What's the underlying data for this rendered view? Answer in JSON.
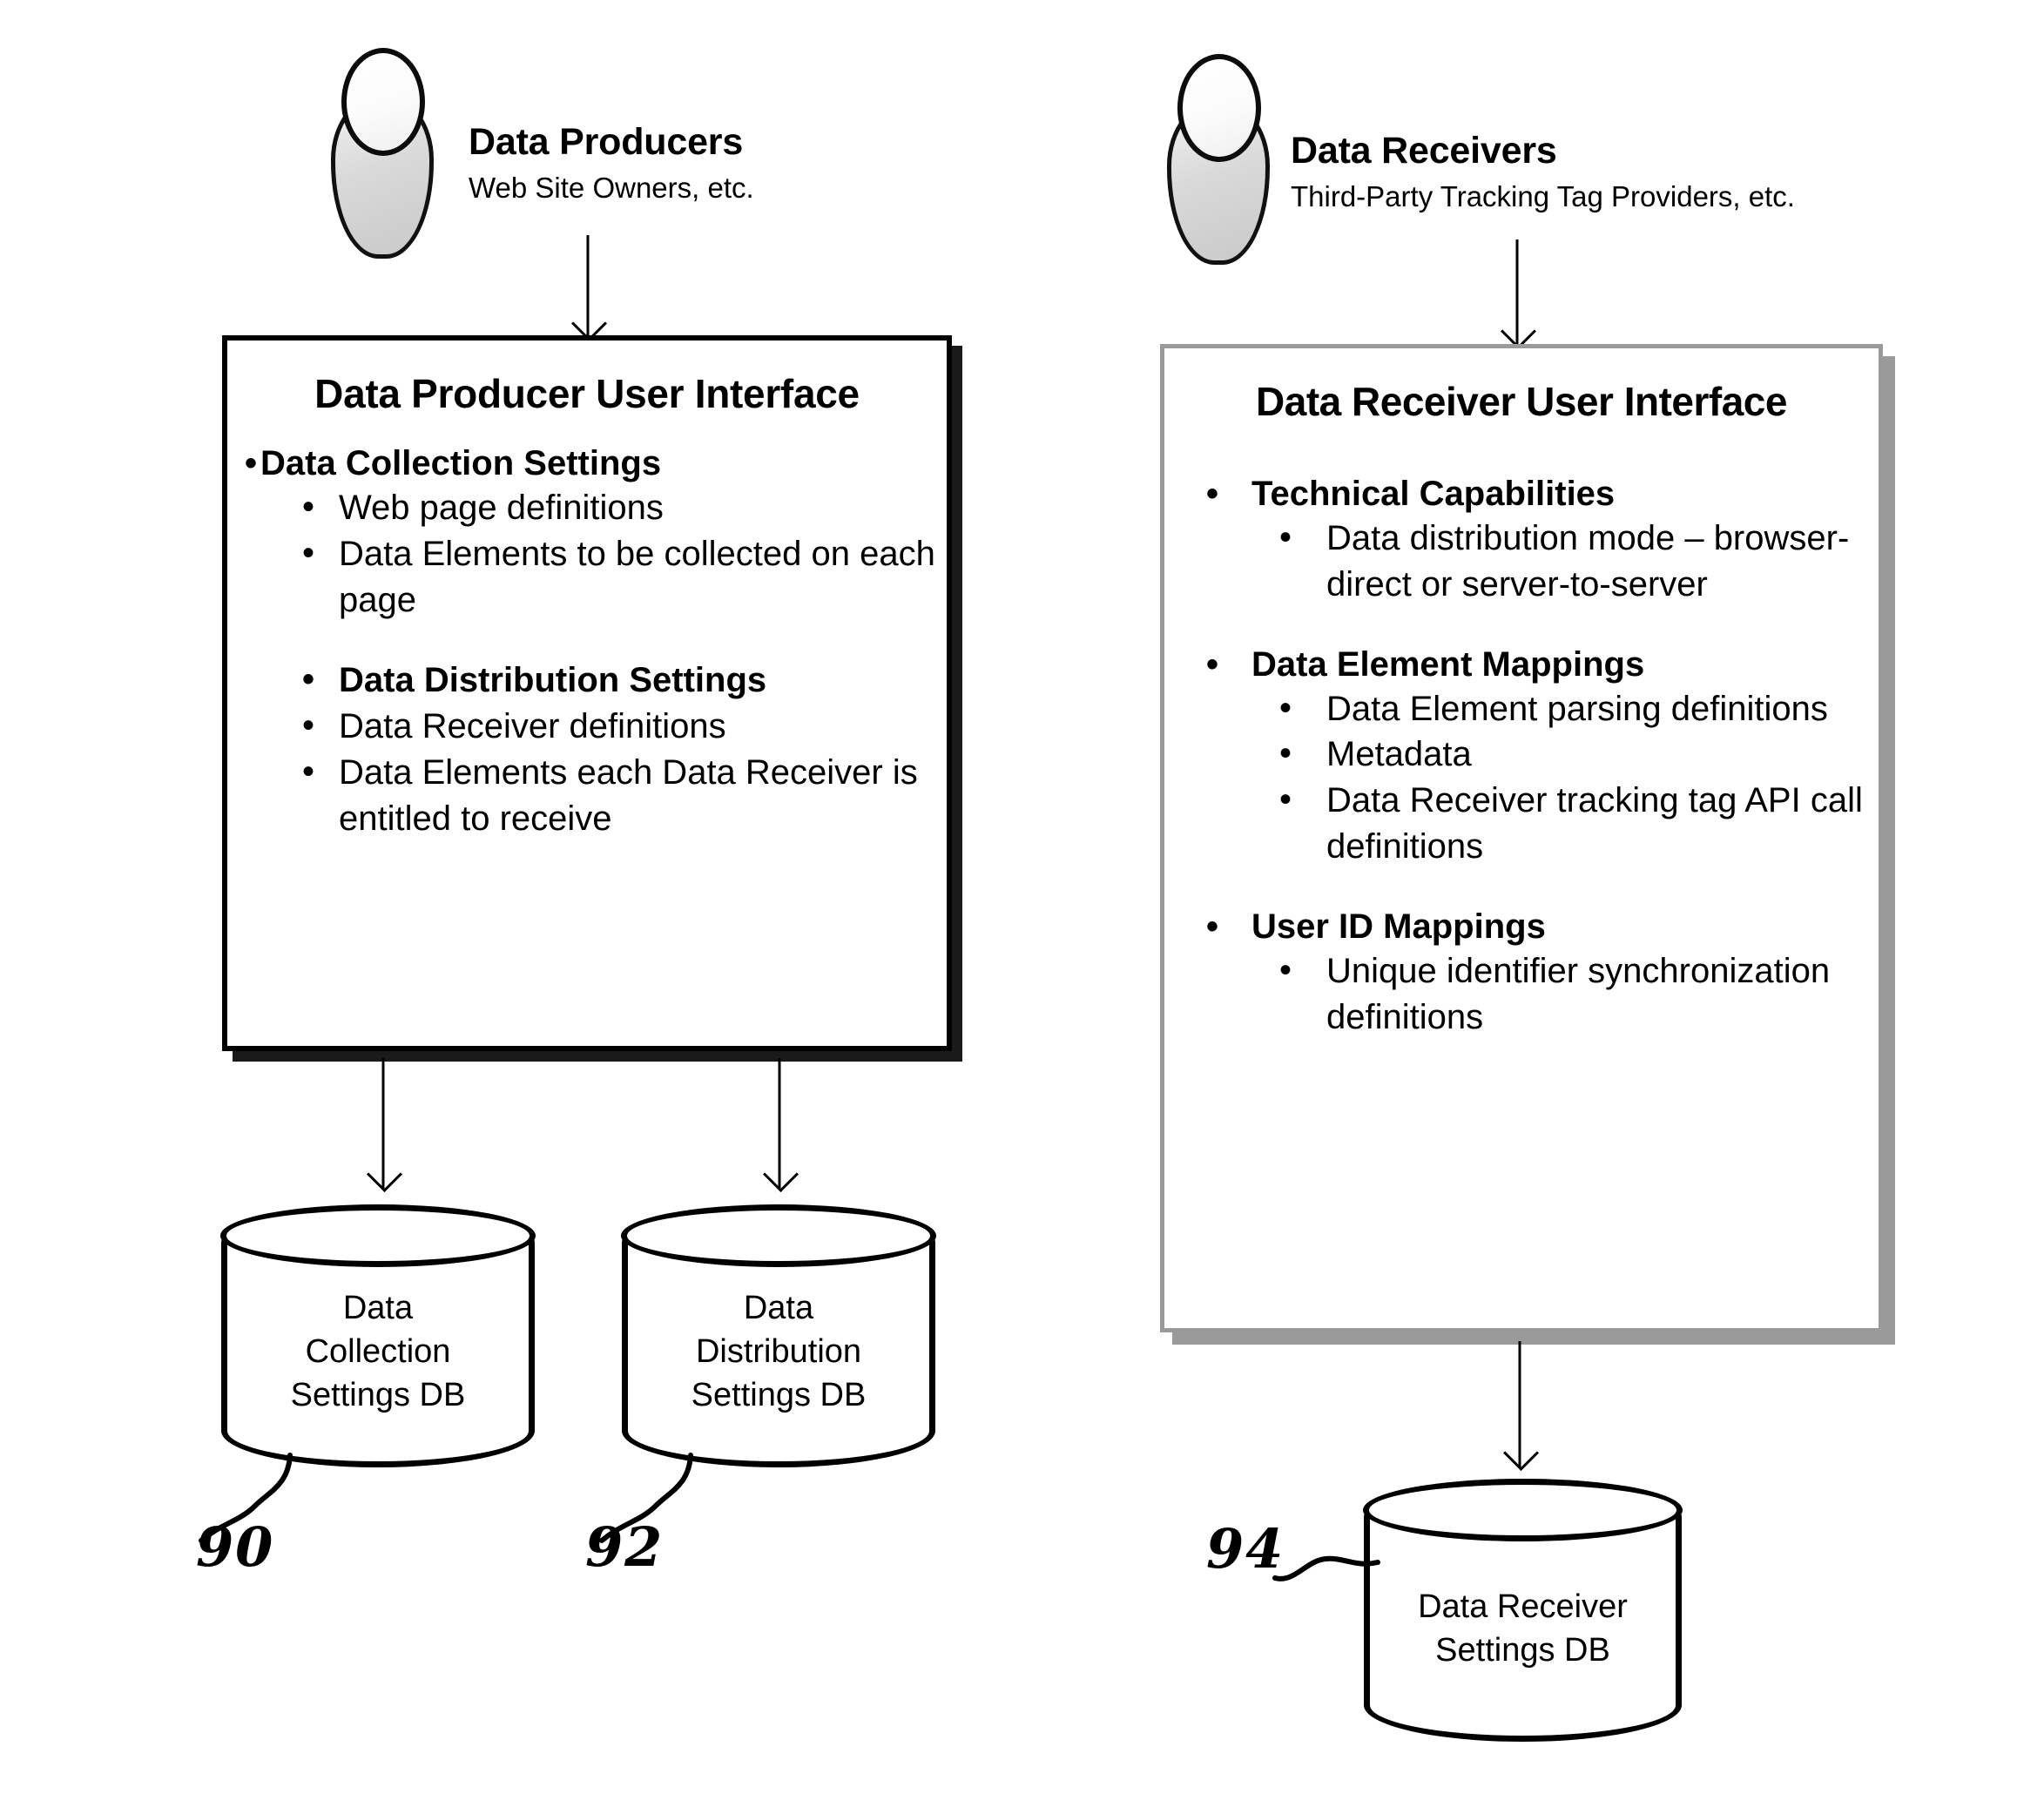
{
  "figure": {
    "kind": "patent-diagram",
    "background_color": "#ffffff",
    "ink_color": "#000000"
  },
  "actors": [
    {
      "id": "data-producers",
      "title": "Data Producers",
      "subtitle": "Web Site Owners, etc."
    },
    {
      "id": "data-receivers",
      "title": "Data Receivers",
      "subtitle": "Third-Party Tracking Tag Providers, etc."
    }
  ],
  "panels": {
    "producer": {
      "title": "Data Producer User Interface",
      "groups": [
        {
          "heading": "Data Collection Settings",
          "items": [
            "Web page definitions",
            "Data Elements to be collected on each page"
          ]
        },
        {
          "heading": "Data Distribution Settings",
          "items": [
            "Data Receiver definitions",
            "Data Elements each Data Receiver is entitled to receive"
          ],
          "headingIsBulletLevel2": true
        }
      ]
    },
    "receiver": {
      "title": "Data Receiver User Interface",
      "groups": [
        {
          "heading": "Technical Capabilities",
          "items": [
            "Data distribution mode – browser-direct or server-to-server"
          ]
        },
        {
          "heading": "Data Element Mappings",
          "items": [
            "Data Element parsing definitions",
            "Metadata",
            "Data Receiver tracking tag API call definitions"
          ]
        },
        {
          "heading": "User ID Mappings",
          "items": [
            "Unique identifier synchronization definitions"
          ]
        }
      ]
    }
  },
  "databases": [
    {
      "id": "data-collection-settings-db",
      "label": "Data\nCollection\nSettings DB",
      "line1": "Data",
      "line2": "Collection",
      "line3": "Settings DB",
      "ref": "90"
    },
    {
      "id": "data-distribution-settings-db",
      "label": "Data\nDistribution\nSettings DB",
      "line1": "Data",
      "line2": "Distribution",
      "line3": "Settings DB",
      "ref": "92"
    },
    {
      "id": "data-receiver-settings-db",
      "label": "Data Receiver\nSettings DB",
      "line1": "Data Receiver",
      "line2": "Settings DB",
      "ref": "94"
    }
  ],
  "reference_numerals": [
    "90",
    "92",
    "94"
  ],
  "connectors": [
    {
      "from": "data-producers",
      "to": "producer-panel"
    },
    {
      "from": "data-receivers",
      "to": "receiver-panel"
    },
    {
      "from": "producer-panel",
      "to": "data-collection-settings-db"
    },
    {
      "from": "producer-panel",
      "to": "data-distribution-settings-db"
    },
    {
      "from": "receiver-panel",
      "to": "data-receiver-settings-db"
    }
  ]
}
